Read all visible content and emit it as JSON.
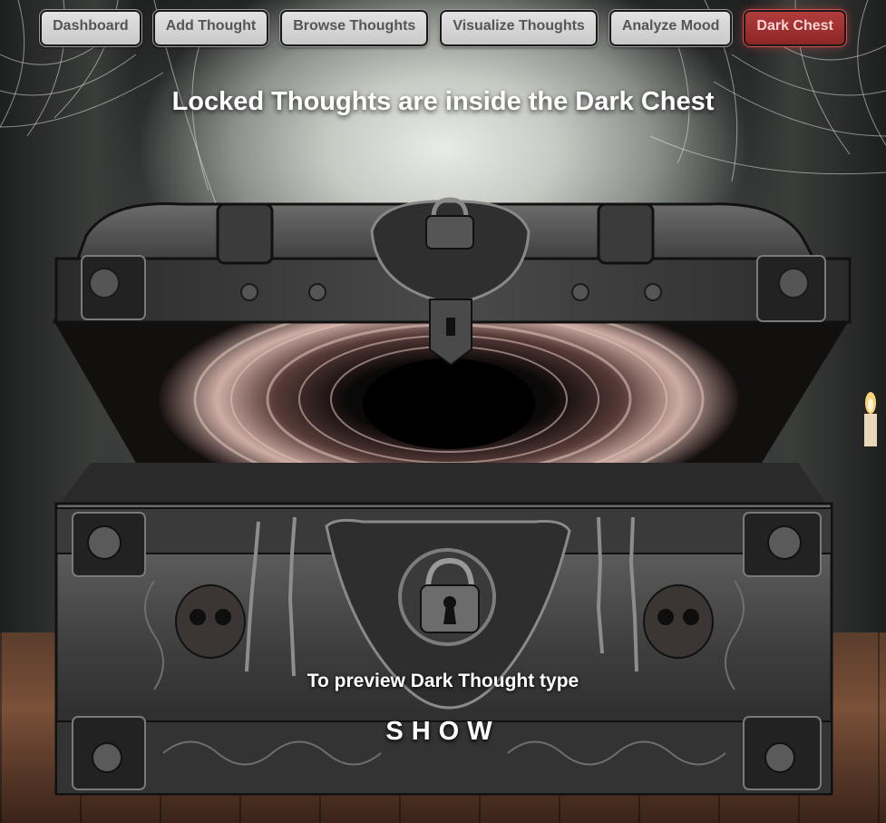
{
  "nav": {
    "items": [
      {
        "label": "Dashboard",
        "active": false
      },
      {
        "label": "Add Thought",
        "active": false
      },
      {
        "label": "Browse Thoughts",
        "active": false
      },
      {
        "label": "Visualize Thoughts",
        "active": false
      },
      {
        "label": "Analyze Mood",
        "active": false
      },
      {
        "label": "Dark Chest",
        "active": true
      }
    ]
  },
  "page": {
    "headline": "Locked Thoughts are inside the Dark Chest",
    "preview_instruction": "To preview Dark Thought type",
    "command_word": "SHOW"
  },
  "colors": {
    "active_nav_bg": "#a83434",
    "active_nav_text": "#ffd2d2",
    "nav_bg": "#d4d4d4",
    "nav_text": "#555555"
  },
  "illustration": {
    "subject": "open dark iron treasure chest with swirling black vortex, padlocks and chains",
    "icons": [
      "padlock-icon",
      "keyhole-icon",
      "chain-icon",
      "skull-icon",
      "candle-icon"
    ]
  }
}
